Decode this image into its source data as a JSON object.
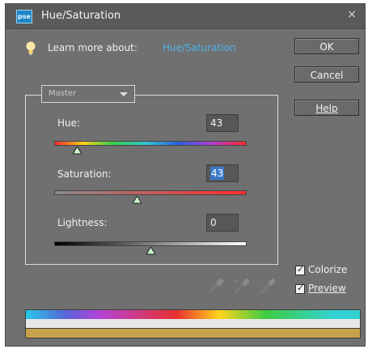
{
  "window": {
    "title": "Hue/Saturation",
    "app_icon": "pse",
    "close": "×"
  },
  "tip": {
    "label": "Learn more about:",
    "link": "Hue/Saturation"
  },
  "buttons": {
    "ok": "OK",
    "cancel": "Cancel",
    "help": "Help"
  },
  "edit_dropdown": {
    "selected": "Master"
  },
  "sliders": {
    "hue": {
      "label": "Hue:",
      "value": "43",
      "level": 0.12
    },
    "saturation": {
      "label": "Saturation:",
      "value": "43",
      "level": 0.43
    },
    "lightness": {
      "label": "Lightness:",
      "value": "0",
      "level": 0.5
    }
  },
  "checkboxes": {
    "colorize": {
      "label": "Colorize",
      "checked": true
    },
    "preview": {
      "label": "Preview",
      "checked": true
    }
  },
  "icons": [
    "bulb-icon",
    "eyedropper-icon",
    "eyedropper-plus-icon",
    "eyedropper-minus-icon",
    "checkmark-icon",
    "chevron-down-icon"
  ],
  "colors": {
    "dialog_bg": "#707070",
    "link": "#4fb3e8",
    "tan_bar": "#c8a24a"
  }
}
